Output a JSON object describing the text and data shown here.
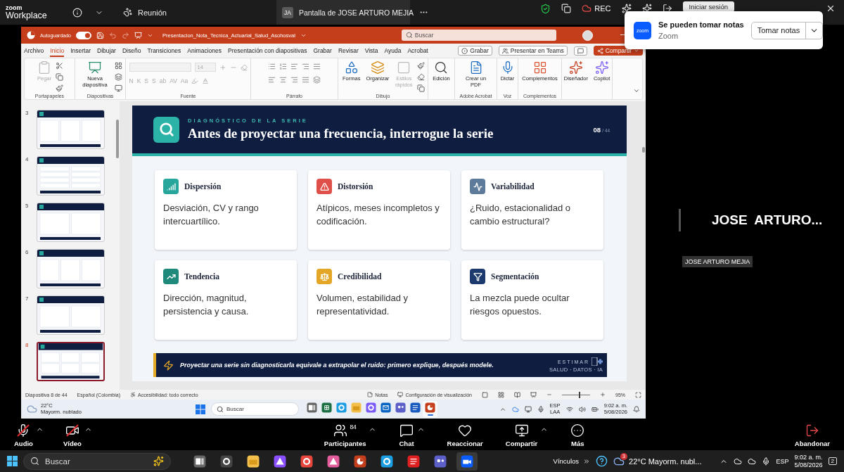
{
  "zoom_top_bar": {
    "brand": "zoom",
    "product": "Workplace",
    "meeting": "Reunión",
    "share_tab": {
      "initials": "JA",
      "label": "Pantalla de JOSE ARTURO MEJIA"
    },
    "recording": "REC",
    "sign_in": "Iniciar sesión"
  },
  "notification": {
    "app_icon_text": "zoom",
    "title": "Se pueden tomar notas",
    "source": "Zoom",
    "action": "Tomar notas"
  },
  "powerpoint": {
    "title_bar": {
      "autosave_label": "Autoguardado",
      "autosave_on": true,
      "filename": "Presentacion_Nota_Tecnica_Actuarial_Salud_Asohosval",
      "search_placeholder": "Buscar"
    },
    "tabs": [
      {
        "label": "Archivo",
        "selected": false
      },
      {
        "label": "Inicio",
        "selected": true
      },
      {
        "label": "Insertar",
        "selected": false
      },
      {
        "label": "Dibujar",
        "selected": false
      },
      {
        "label": "Diseño",
        "selected": false
      },
      {
        "label": "Transiciones",
        "selected": false
      },
      {
        "label": "Animaciones",
        "selected": false
      },
      {
        "label": "Presentación con diapositivas",
        "selected": false
      },
      {
        "label": "Grabar",
        "selected": false
      },
      {
        "label": "Revisar",
        "selected": false
      },
      {
        "label": "Vista",
        "selected": false
      },
      {
        "label": "Ayuda",
        "selected": false
      },
      {
        "label": "Acrobat",
        "selected": false
      }
    ],
    "tab_actions": [
      {
        "kind": "record",
        "label": "Grabar"
      },
      {
        "kind": "teams",
        "label": "Presentar en Teams"
      },
      {
        "kind": "comments"
      },
      {
        "kind": "share",
        "label": "Compartir"
      }
    ],
    "ribbon": [
      {
        "kind": "clipboard",
        "label": "Portapapeles",
        "buttons": [
          {
            "kind": "paste",
            "label": "Pegar",
            "disabled": true
          }
        ]
      },
      {
        "kind": "slides",
        "label": "Diapositivas",
        "buttons": [
          {
            "kind": "new-slide",
            "label": "Nueva diapositiva",
            "disabled": false
          }
        ]
      },
      {
        "kind": "font",
        "label": "Fuente",
        "font_size": "14",
        "format": [
          "N",
          "K",
          "S",
          "S",
          "ab",
          "AV",
          "Aa"
        ],
        "disabled": true
      },
      {
        "kind": "paragraph",
        "label": "Párrafo"
      },
      {
        "kind": "drawing",
        "label": "Dibujo",
        "buttons": [
          {
            "kind": "shapes",
            "label": "Formas",
            "disabled": false
          },
          {
            "kind": "arrange",
            "label": "Organizar",
            "disabled": false
          },
          {
            "kind": "styles",
            "label": "Estilos rápidos",
            "disabled": true
          }
        ]
      },
      {
        "kind": "editing",
        "buttons": [
          {
            "kind": "find",
            "label": "Edición",
            "disabled": false
          }
        ]
      },
      {
        "kind": "acrobat",
        "label": "Adobe Acrobat",
        "buttons": [
          {
            "kind": "pdf",
            "label": "Crear un PDF",
            "disabled": false
          }
        ]
      },
      {
        "kind": "voice",
        "label": "Voz",
        "buttons": [
          {
            "kind": "mic",
            "label": "Dictar",
            "disabled": false
          }
        ]
      },
      {
        "kind": "addins",
        "label": "Complementos",
        "buttons": [
          {
            "kind": "addins",
            "label": "Complementos",
            "disabled": false
          }
        ]
      },
      {
        "kind": "ai",
        "buttons": [
          {
            "kind": "designer",
            "label": "Diseñador",
            "disabled": false
          },
          {
            "kind": "copilot",
            "label": "Copilot",
            "disabled": false
          }
        ]
      }
    ],
    "thumbnails": [
      {
        "number": "3",
        "selected": false
      },
      {
        "number": "4",
        "selected": false
      },
      {
        "number": "5",
        "selected": false
      },
      {
        "number": "6",
        "selected": false
      },
      {
        "number": "7",
        "selected": false
      },
      {
        "number": "8",
        "selected": true
      }
    ],
    "slide": {
      "eyebrow": "DIAGNÓSTICO DE LA SERIE",
      "title": "Antes de proyectar una frecuencia, interrogue la serie",
      "page": "08",
      "total": "/ 44",
      "cards": [
        {
          "kind": "bars",
          "color": "#27a79c",
          "title": "Dispersión",
          "text": "Desviación, CV y rango intercuartílico."
        },
        {
          "kind": "alert",
          "color": "#e0504a",
          "title": "Distorsión",
          "text": "Atípicos, meses incompletos y codificación."
        },
        {
          "kind": "wave",
          "color": "#5f7b9c",
          "title": "Variabilidad",
          "text": "¿Ruido, estacionalidad o cambio estructural?"
        },
        {
          "kind": "trend",
          "color": "#1f8a7c",
          "title": "Tendencia",
          "text": "Dirección, magnitud, persistencia y causa."
        },
        {
          "kind": "scale",
          "color": "#e3a626",
          "title": "Credibilidad",
          "text": "Volumen, estabilidad y representatividad."
        },
        {
          "kind": "filter",
          "color": "#1c3a6e",
          "title": "Segmentación",
          "text": "La mezcla puede ocultar riesgos opuestos."
        }
      ],
      "footer": {
        "text": "Proyectar una serie sin diagnosticarla equivale a extrapolar el ruido: primero explique, después modele.",
        "logo": "ESTIMAR",
        "tagline": "SALUD · DATOS · IA"
      }
    },
    "status_bar": {
      "slide": "Diapositiva 8 de 44",
      "language": "Español (Colombia)",
      "accessibility": "Accesibilidad: todo correcto",
      "notes": "Notas",
      "view_settings": "Configuración de visualización",
      "zoom_slider": {
        "level": 0.6
      },
      "zoom": "95%"
    },
    "taskbar": {
      "temperature": "22°C",
      "weather": "Mayorm. nublado",
      "search_placeholder": "Buscar",
      "language": "ESP",
      "layout": "LAA",
      "time": "9:02 a. m.",
      "date": "5/08/2026",
      "apps": [
        {
          "kind": "task-view",
          "selected": false
        },
        {
          "kind": "excel",
          "selected": false
        },
        {
          "kind": "edge",
          "selected": false
        },
        {
          "kind": "folder",
          "selected": false
        },
        {
          "kind": "copilot",
          "selected": false
        },
        {
          "kind": "outlook",
          "selected": false
        },
        {
          "kind": "teams",
          "selected": false
        },
        {
          "kind": "word",
          "selected": false
        },
        {
          "kind": "powerpoint",
          "selected": true
        }
      ]
    }
  },
  "participant": {
    "display_name": "JOSE ARTURO...",
    "name_label": "JOSE ARTURO MEJIA"
  },
  "zoom_toolbar": {
    "left": [
      {
        "kind": "audio",
        "label": "Audio",
        "muted": true,
        "menu": true
      },
      {
        "kind": "video",
        "label": "Vídeo",
        "muted": true,
        "menu": true
      }
    ],
    "center": [
      {
        "kind": "participants",
        "label": "Participantes",
        "count": "84",
        "menu": true
      },
      {
        "kind": "chat",
        "label": "Chat",
        "menu": true
      },
      {
        "kind": "react",
        "label": "Reaccionar",
        "menu": false
      },
      {
        "kind": "share",
        "label": "Compartir",
        "menu": true
      },
      {
        "kind": "more",
        "label": "Más",
        "menu": false
      }
    ],
    "right": [
      {
        "kind": "leave",
        "label": "Abandonar",
        "menu": false
      }
    ]
  },
  "taskbar": {
    "search_placeholder": "Buscar",
    "apps": [
      {
        "kind": "task-view",
        "selected": false
      },
      {
        "kind": "obs",
        "selected": false
      },
      {
        "kind": "folder",
        "selected": false
      },
      {
        "kind": "affinity",
        "selected": false
      },
      {
        "kind": "chrome",
        "selected": false
      },
      {
        "kind": "snip",
        "selected": false
      },
      {
        "kind": "powerpoint",
        "selected": false
      },
      {
        "kind": "edge",
        "selected": false
      },
      {
        "kind": "wps",
        "selected": false
      },
      {
        "kind": "teams",
        "selected": false
      },
      {
        "kind": "zoom",
        "selected": true
      }
    ],
    "links": "Vínculos",
    "weather_alerts": "3",
    "temperature": "22°C",
    "weather": "Mayorm. nubl...",
    "language": "ESP",
    "time": "9:02 a. m.",
    "date": "5/08/2026",
    "notifications": "2"
  }
}
